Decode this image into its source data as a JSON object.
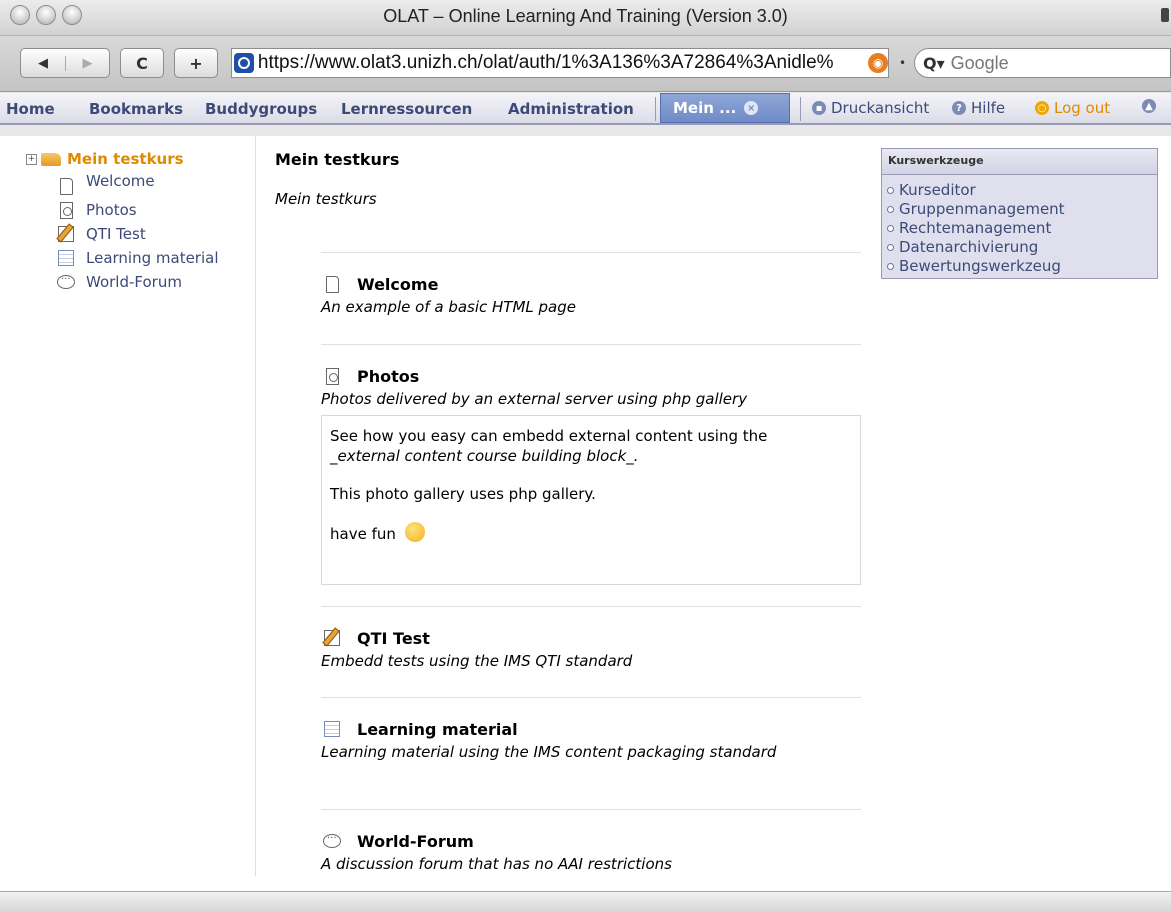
{
  "window": {
    "title": "OLAT – Online Learning And Training (Version 3.0)"
  },
  "browser": {
    "back_icon": "◀",
    "forward_icon": "▶",
    "reload_icon": "C",
    "add_icon": "+",
    "url": "https://www.olat3.unizh.ch/olat/auth/1%3A136%3A72864%3Anidle%",
    "search_placeholder": "Google"
  },
  "nav": {
    "items": [
      "Home",
      "Bookmarks",
      "Buddygroups",
      "Lernressourcen",
      "Administration"
    ],
    "active_tab": "Mein ...",
    "print_label": "Druckansicht",
    "help_label": "Hilfe",
    "logout_label": "Log out"
  },
  "tree": {
    "root": "Mein testkurs",
    "items": [
      "Welcome",
      "Photos",
      "QTI Test",
      "Learning material",
      "World-Forum"
    ]
  },
  "main": {
    "title": "Mein testkurs",
    "subtitle": "Mein testkurs",
    "blocks": [
      {
        "title": "Welcome",
        "desc": "An example of a basic HTML page"
      },
      {
        "title": "Photos",
        "desc": "Photos delivered by an external server using php gallery"
      },
      {
        "title": "QTI Test",
        "desc": "Embedd tests using the IMS QTI standard"
      },
      {
        "title": "Learning material",
        "desc": "Learning material using the IMS content packaging standard"
      },
      {
        "title": "World-Forum",
        "desc": "A discussion forum that has no AAI restrictions"
      }
    ],
    "external": {
      "line1": "See how you easy can embedd external content using the",
      "line2": "_external content course building block_.",
      "line3": "This photo gallery uses php gallery.",
      "line4": "have fun"
    }
  },
  "tools": {
    "header": "Kurswerkzeuge",
    "items": [
      "Kurseditor",
      "Gruppenmanagement",
      "Rechtemanagement",
      "Datenarchivierung",
      "Bewertungswerkzeug"
    ]
  }
}
